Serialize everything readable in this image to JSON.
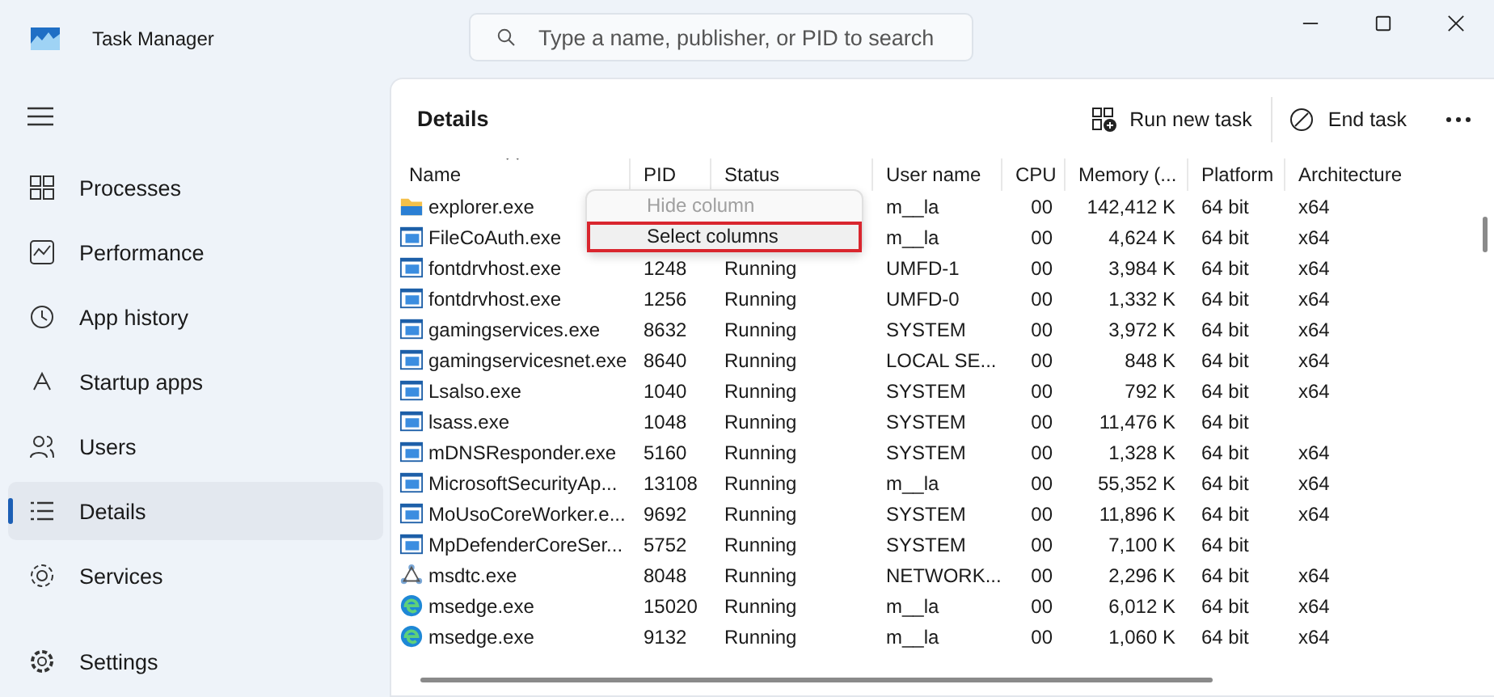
{
  "window": {
    "title": "Task Manager"
  },
  "search": {
    "placeholder": "Type a name, publisher, or PID to search"
  },
  "sidebar": {
    "items": [
      {
        "label": "Processes",
        "selected": false
      },
      {
        "label": "Performance",
        "selected": false
      },
      {
        "label": "App history",
        "selected": false
      },
      {
        "label": "Startup apps",
        "selected": false
      },
      {
        "label": "Users",
        "selected": false
      },
      {
        "label": "Details",
        "selected": true
      },
      {
        "label": "Services",
        "selected": false
      }
    ],
    "footer": {
      "label": "Settings"
    }
  },
  "page": {
    "title": "Details",
    "actions": [
      {
        "label": "Run new task"
      },
      {
        "label": "End task"
      }
    ]
  },
  "table": {
    "columns": [
      {
        "label": "Name",
        "sorted": true
      },
      {
        "label": "PID",
        "sorted": false
      },
      {
        "label": "Status",
        "sorted": false
      },
      {
        "label": "User name",
        "sorted": false
      },
      {
        "label": "CPU",
        "sorted": false
      },
      {
        "label": "Memory (...",
        "sorted": false
      },
      {
        "label": "Platform",
        "sorted": false
      },
      {
        "label": "Architecture",
        "sorted": false
      }
    ],
    "rows": [
      {
        "kind": "folder",
        "cells": [
          "explorer.exe",
          "",
          "",
          "m__la",
          "00",
          "142,412 K",
          "64 bit",
          "x64"
        ]
      },
      {
        "kind": "app",
        "cells": [
          "FileCoAuth.exe",
          "",
          "",
          "m__la",
          "00",
          "4,624 K",
          "64 bit",
          "x64"
        ]
      },
      {
        "kind": "app",
        "cells": [
          "fontdrvhost.exe",
          "1248",
          "Running",
          "UMFD-1",
          "00",
          "3,984 K",
          "64 bit",
          "x64"
        ]
      },
      {
        "kind": "app",
        "cells": [
          "fontdrvhost.exe",
          "1256",
          "Running",
          "UMFD-0",
          "00",
          "1,332 K",
          "64 bit",
          "x64"
        ]
      },
      {
        "kind": "app",
        "cells": [
          "gamingservices.exe",
          "8632",
          "Running",
          "SYSTEM",
          "00",
          "3,972 K",
          "64 bit",
          "x64"
        ]
      },
      {
        "kind": "app",
        "cells": [
          "gamingservicesnet.exe",
          "8640",
          "Running",
          "LOCAL SE...",
          "00",
          "848 K",
          "64 bit",
          "x64"
        ]
      },
      {
        "kind": "app",
        "cells": [
          "Lsalso.exe",
          "1040",
          "Running",
          "SYSTEM",
          "00",
          "792 K",
          "64 bit",
          "x64"
        ]
      },
      {
        "kind": "app",
        "cells": [
          "lsass.exe",
          "1048",
          "Running",
          "SYSTEM",
          "00",
          "11,476 K",
          "64 bit",
          ""
        ]
      },
      {
        "kind": "app",
        "cells": [
          "mDNSResponder.exe",
          "5160",
          "Running",
          "SYSTEM",
          "00",
          "1,328 K",
          "64 bit",
          "x64"
        ]
      },
      {
        "kind": "app",
        "cells": [
          "MicrosoftSecurityAp...",
          "13108",
          "Running",
          "m__la",
          "00",
          "55,352 K",
          "64 bit",
          "x64"
        ]
      },
      {
        "kind": "app",
        "cells": [
          "MoUsoCoreWorker.e...",
          "9692",
          "Running",
          "SYSTEM",
          "00",
          "11,896 K",
          "64 bit",
          "x64"
        ]
      },
      {
        "kind": "app",
        "cells": [
          "MpDefenderCoreSer...",
          "5752",
          "Running",
          "SYSTEM",
          "00",
          "7,100 K",
          "64 bit",
          ""
        ]
      },
      {
        "kind": "network",
        "cells": [
          "msdtc.exe",
          "8048",
          "Running",
          "NETWORK...",
          "00",
          "2,296 K",
          "64 bit",
          "x64"
        ]
      },
      {
        "kind": "edge",
        "cells": [
          "msedge.exe",
          "15020",
          "Running",
          "m__la",
          "00",
          "6,012 K",
          "64 bit",
          "x64"
        ]
      },
      {
        "kind": "edge",
        "cells": [
          "msedge.exe",
          "9132",
          "Running",
          "m__la",
          "00",
          "1,060 K",
          "64 bit",
          "x64"
        ]
      }
    ]
  },
  "context_menu": {
    "items": [
      {
        "label": "Hide column",
        "disabled": true,
        "highlighted": false
      },
      {
        "label": "Select columns",
        "disabled": false,
        "highlighted": true
      }
    ]
  }
}
